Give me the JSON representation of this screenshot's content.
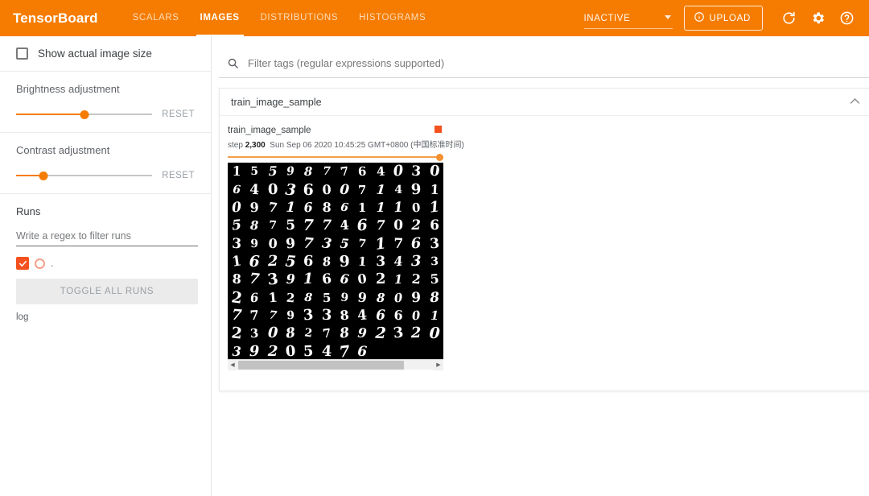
{
  "header": {
    "brand": "TensorBoard",
    "tabs": [
      {
        "label": "SCALARS",
        "active": false
      },
      {
        "label": "IMAGES",
        "active": true
      },
      {
        "label": "DISTRIBUTIONS",
        "active": false
      },
      {
        "label": "HISTOGRAMS",
        "active": false
      }
    ],
    "run_status": "INACTIVE",
    "upload_label": "UPLOAD",
    "icons": [
      "info-icon",
      "refresh-icon",
      "settings-gear-icon",
      "help-circle-icon"
    ],
    "accent_color": "#f57c00"
  },
  "sidebar": {
    "show_actual_size": {
      "label": "Show actual image size",
      "checked": false
    },
    "brightness": {
      "label": "Brightness adjustment",
      "reset_label": "RESET",
      "value_pct": 50
    },
    "contrast": {
      "label": "Contrast adjustment",
      "reset_label": "RESET",
      "value_pct": 20
    },
    "runs": {
      "title": "Runs",
      "regex_placeholder": "Write a regex to filter runs",
      "regex_value": "",
      "items": [
        {
          "name": ".",
          "checked": true,
          "color": "#f4511e"
        }
      ],
      "toggle_all_label": "TOGGLE ALL RUNS",
      "log_label": "log"
    }
  },
  "main": {
    "filter": {
      "placeholder": "Filter tags (regular expressions supported)",
      "value": "",
      "icon": "search-icon"
    },
    "card": {
      "title": "train_image_sample",
      "collapse_icon": "chevron-up-icon",
      "image": {
        "tag": "train_image_sample",
        "step_label": "step",
        "step_value": "2,300",
        "timestamp": "Sun Sep 06 2020 10:45:25 GMT+0800 (中国标准时间)",
        "run_color": "#f4511e",
        "step_slider_pct": 100,
        "grid": {
          "columns": 12,
          "rows": [
            [
              "1",
              "5",
              "5",
              "9",
              "8",
              "7",
              "7",
              "6",
              "4",
              "0",
              "3",
              "0"
            ],
            [
              "6",
              "4",
              "0",
              "3",
              "6",
              "0",
              "0",
              "7",
              "1",
              "4",
              "9",
              "1"
            ],
            [
              "0",
              "9",
              "7",
              "1",
              "6",
              "8",
              "6",
              "1",
              "1",
              "1",
              "0",
              "1"
            ],
            [
              "5",
              "8",
              "7",
              "5",
              "7",
              "7",
              "4",
              "6",
              "7",
              "0",
              "2",
              "6"
            ],
            [
              "3",
              "9",
              "0",
              "9",
              "7",
              "3",
              "5",
              "7",
              "1",
              "7",
              "6",
              "3"
            ],
            [
              "1",
              "6",
              "2",
              "5",
              "6",
              "8",
              "9",
              "1",
              "3",
              "4",
              "3",
              "3"
            ],
            [
              "8",
              "7",
              "3",
              "9",
              "1",
              "6",
              "6",
              "0",
              "2",
              "1",
              "2",
              "5"
            ],
            [
              "2",
              "6",
              "1",
              "2",
              "8",
              "5",
              "9",
              "9",
              "8",
              "0",
              "9",
              "8"
            ],
            [
              "7",
              "7",
              "7",
              "9",
              "3",
              "3",
              "8",
              "4",
              "6",
              "6",
              "0",
              "1"
            ],
            [
              "2",
              "3",
              "0",
              "8",
              "2",
              "7",
              "8",
              "9",
              "2",
              "3",
              "2",
              "0"
            ],
            [
              "3",
              "9",
              "2",
              "0",
              "5",
              "4",
              "7",
              "6",
              "",
              "",
              "",
              ""
            ]
          ]
        },
        "scrollbar": {
          "thumb_pct": 85,
          "left_arrow": "◀",
          "right_arrow": "▶"
        }
      }
    }
  }
}
